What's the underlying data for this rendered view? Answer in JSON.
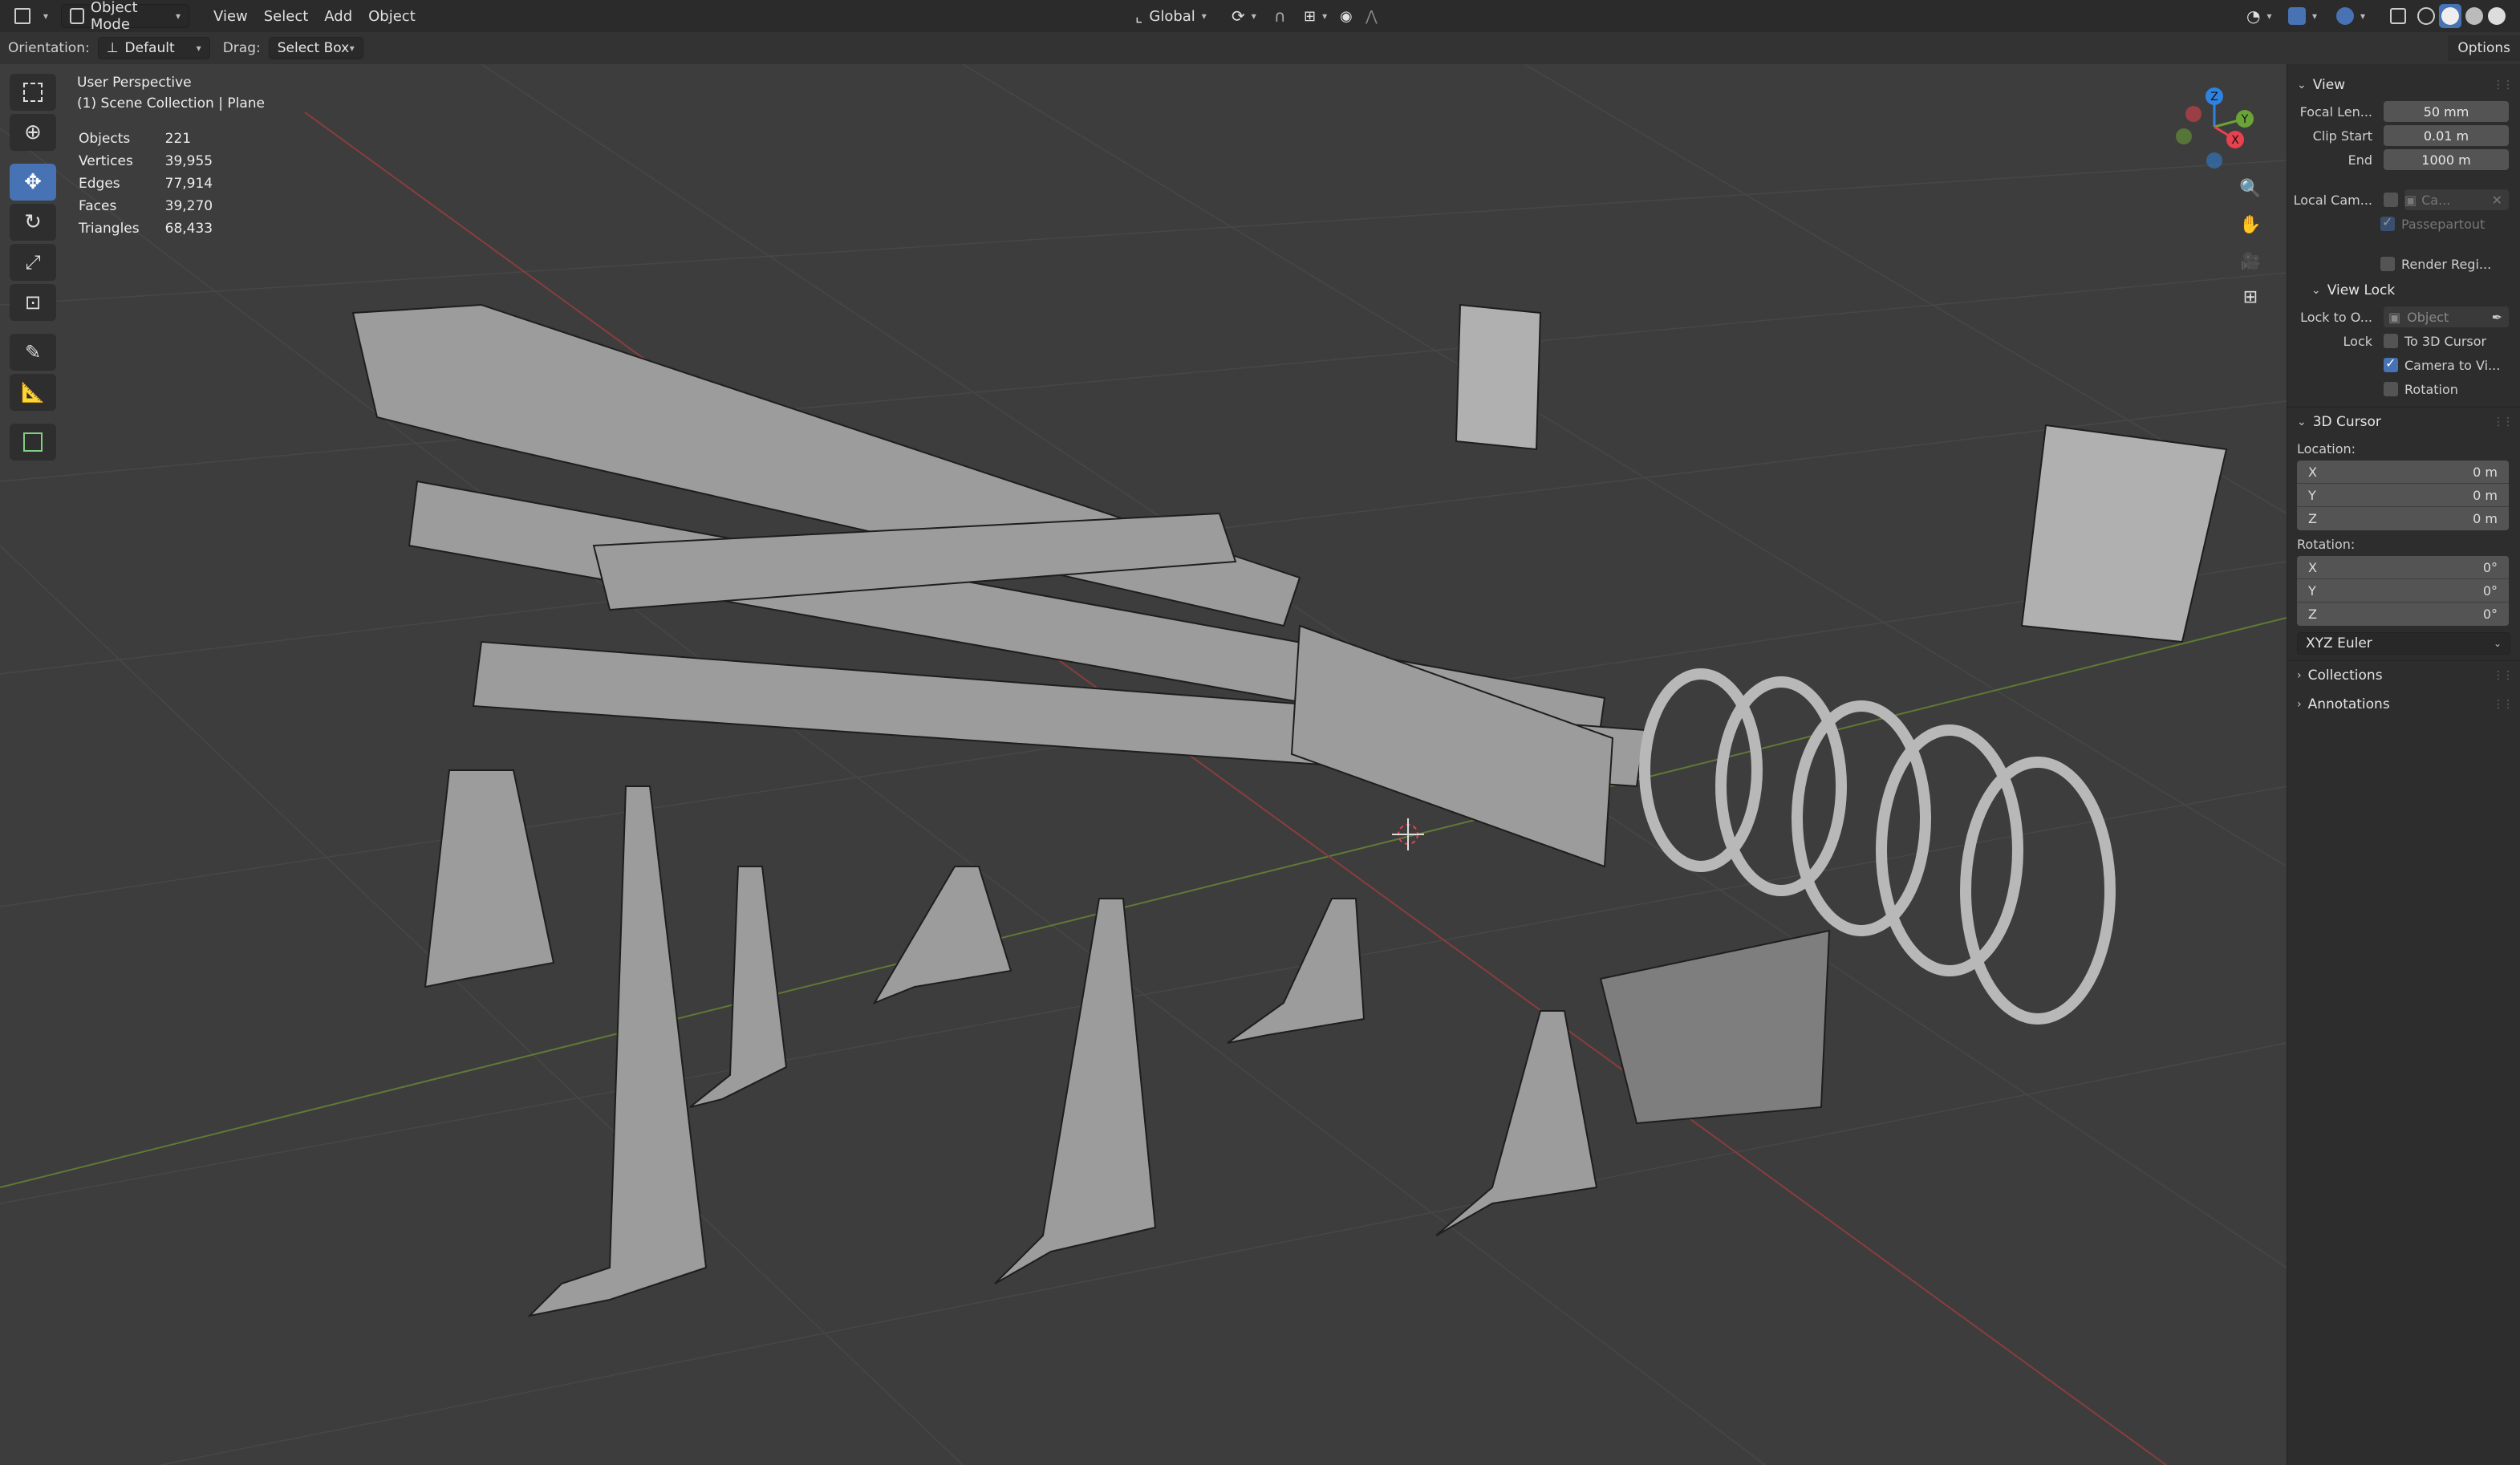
{
  "header": {
    "mode": "Object Mode",
    "menus": [
      "View",
      "Select",
      "Add",
      "Object"
    ],
    "transform_orientation": "Global"
  },
  "toolrow": {
    "orientation_label": "Orientation:",
    "orientation_value": "Default",
    "drag_label": "Drag:",
    "drag_value": "Select Box",
    "options_label": "Options"
  },
  "overlay": {
    "perspective": "User Perspective",
    "collection": "(1) Scene Collection | Plane",
    "stats": [
      {
        "label": "Objects",
        "value": "221"
      },
      {
        "label": "Vertices",
        "value": "39,955"
      },
      {
        "label": "Edges",
        "value": "77,914"
      },
      {
        "label": "Faces",
        "value": "39,270"
      },
      {
        "label": "Triangles",
        "value": "68,433"
      }
    ]
  },
  "gizmo": {
    "z": "Z",
    "y": "Y",
    "x": "X"
  },
  "npanel": {
    "view": {
      "title": "View",
      "focal_label": "Focal Len...",
      "focal_value": "50 mm",
      "clip_start_label": "Clip Start",
      "clip_start_value": "0.01 m",
      "end_label": "End",
      "end_value": "1000 m",
      "local_cam_label": "Local Cam...",
      "local_cam_value": "Ca...",
      "passepartout": "Passepartout",
      "render_region": "Render Regi..."
    },
    "view_lock": {
      "title": "View Lock",
      "lock_to_label": "Lock to O...",
      "lock_to_placeholder": "Object",
      "lock_label": "Lock",
      "to_cursor": "To 3D Cursor",
      "camera_to_view": "Camera to Vi...",
      "rotation": "Rotation"
    },
    "cursor": {
      "title": "3D Cursor",
      "location_label": "Location:",
      "location": [
        {
          "axis": "X",
          "value": "0 m"
        },
        {
          "axis": "Y",
          "value": "0 m"
        },
        {
          "axis": "Z",
          "value": "0 m"
        }
      ],
      "rotation_label": "Rotation:",
      "rotation": [
        {
          "axis": "X",
          "value": "0°"
        },
        {
          "axis": "Y",
          "value": "0°"
        },
        {
          "axis": "Z",
          "value": "0°"
        }
      ],
      "rotation_mode": "XYZ Euler"
    },
    "collections": "Collections",
    "annotations": "Annotations"
  },
  "colors": {
    "accent": "#4772b3",
    "axis_x": "#e8414f",
    "axis_y": "#6aa436",
    "axis_z": "#2f83e0"
  }
}
